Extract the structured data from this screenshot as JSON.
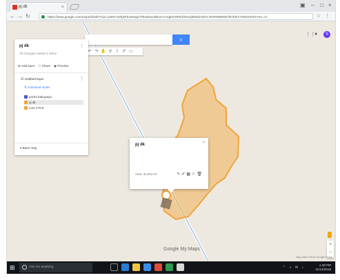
{
  "browser": {
    "tab_title": "pj dk",
    "url": "https://www.google.com/maps/d/edit?mid=1w8KYsdKjsFbuaOqqz7RkwbaxcBbmA17sqjDIc9PE2fDeAjd6WulndSH-2K8PD8tMW7f57bZIY7SWnHK5TV4u=17"
  },
  "panel": {
    "title": "pj dk",
    "description": "All changes saved in Drive",
    "actions": [
      "Add layer",
      "Share",
      "Preview"
    ],
    "layer_title": "Untitled layer",
    "layer_link": "Individual styles",
    "items": [
      "purba bakupaya",
      "pj dk",
      "Line 275.9"
    ],
    "basemap": "Base map"
  },
  "popup": {
    "title": "pj dk",
    "area": "Area: 31,944 m²",
    "close": "×"
  },
  "map": {
    "polygon_color": "#f2a33a",
    "road_color": "#a8c8e8",
    "logo": "Google My Maps",
    "footer": "Map data ©2016 Google  Terms"
  },
  "taskbar": {
    "search_placeholder": "Ask me anything",
    "time": "1:49 PM",
    "date": "11/14/2016"
  },
  "icons": [
    "search-icon",
    "menu-kebab-icon",
    "close-icon",
    "back-arrow-icon",
    "refresh-icon",
    "zoom-in-icon",
    "zoom-out-icon",
    "pin-icon",
    "windows-start-icon"
  ]
}
